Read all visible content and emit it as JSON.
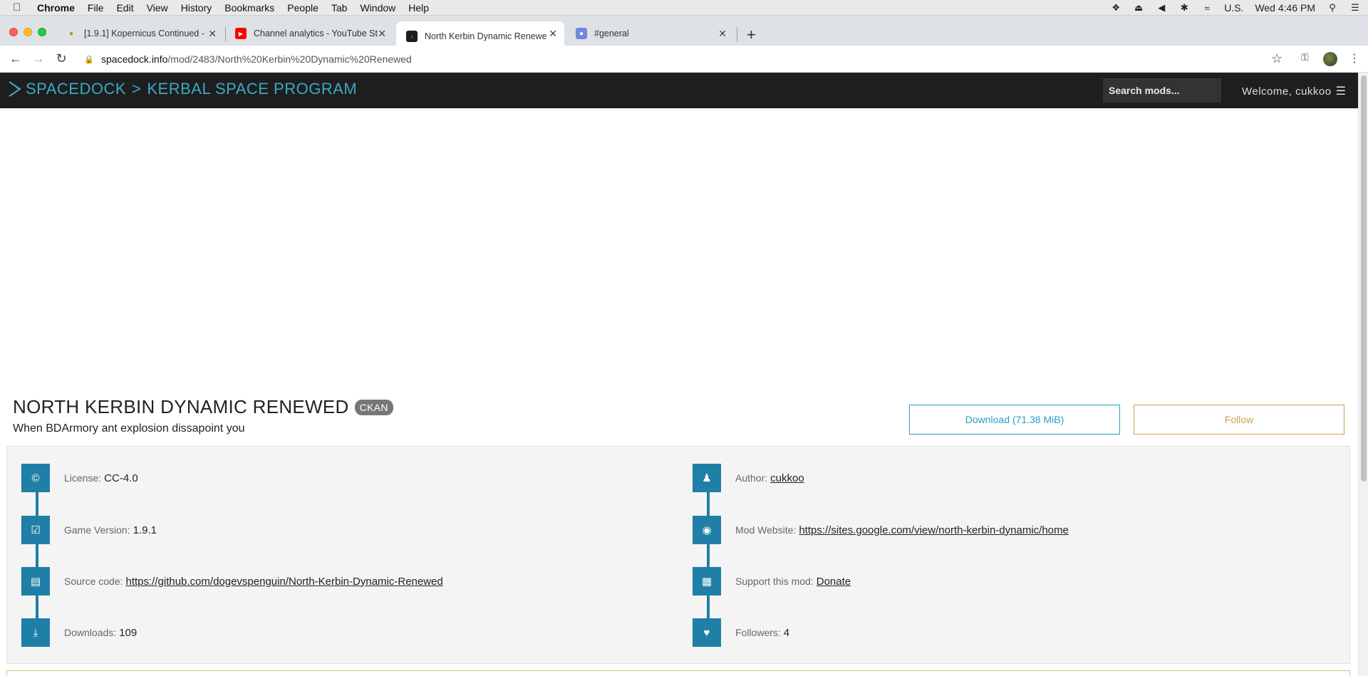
{
  "menubar": {
    "app": "Chrome",
    "items": [
      "File",
      "Edit",
      "View",
      "History",
      "Bookmarks",
      "People",
      "Tab",
      "Window",
      "Help"
    ],
    "input_source": "U.S.",
    "clock": "Wed 4:46 PM"
  },
  "tabs": [
    {
      "title": "[1.9.1] Kopernicus Continued - ",
      "icon": "kopernicus-favicon"
    },
    {
      "title": "Channel analytics - YouTube St",
      "icon": "youtube-favicon"
    },
    {
      "title": "North Kerbin Dynamic Renewe",
      "icon": "spacedock-favicon",
      "active": true
    },
    {
      "title": "#general",
      "icon": "discord-favicon"
    }
  ],
  "address": {
    "host": "spacedock.info",
    "path": "/mod/2483/North%20Kerbin%20Dynamic%20Renewed"
  },
  "site": {
    "brand": "SPACEDOCK",
    "separator": ">",
    "section": "KERBAL SPACE PROGRAM",
    "search_placeholder": "Search mods...",
    "welcome": "Welcome, cukkoo",
    "accent_color": "#3aa8c8"
  },
  "mod": {
    "title": "NORTH KERBIN DYNAMIC RENEWED",
    "badge": "CKAN",
    "subtitle": "When BDArmory ant explosion dissapoint you",
    "download_label": "Download (71.38 MiB)",
    "follow_label": "Follow"
  },
  "info": {
    "left": [
      {
        "label": "License:",
        "value": "CC-4.0",
        "icon": "copyright-icon"
      },
      {
        "label": "Game Version:",
        "value": "1.9.1",
        "icon": "check-square-icon"
      },
      {
        "label": "Source code:",
        "value": "https://github.com/dogevspenguin/North-Kerbin-Dynamic-Renewed",
        "icon": "server-icon",
        "link": true
      },
      {
        "label": "Downloads:",
        "value": "109",
        "icon": "download-icon"
      }
    ],
    "right": [
      {
        "label": "Author:",
        "value": "cukkoo",
        "icon": "user-icon",
        "link": true
      },
      {
        "label": "Mod Website:",
        "value": "https://sites.google.com/view/north-kerbin-dynamic/home",
        "icon": "globe-icon",
        "link": true
      },
      {
        "label": "Support this mod:",
        "value": "Donate",
        "icon": "gift-icon",
        "link": true
      },
      {
        "label": "Followers:",
        "value": "4",
        "icon": "heart-icon"
      }
    ]
  }
}
